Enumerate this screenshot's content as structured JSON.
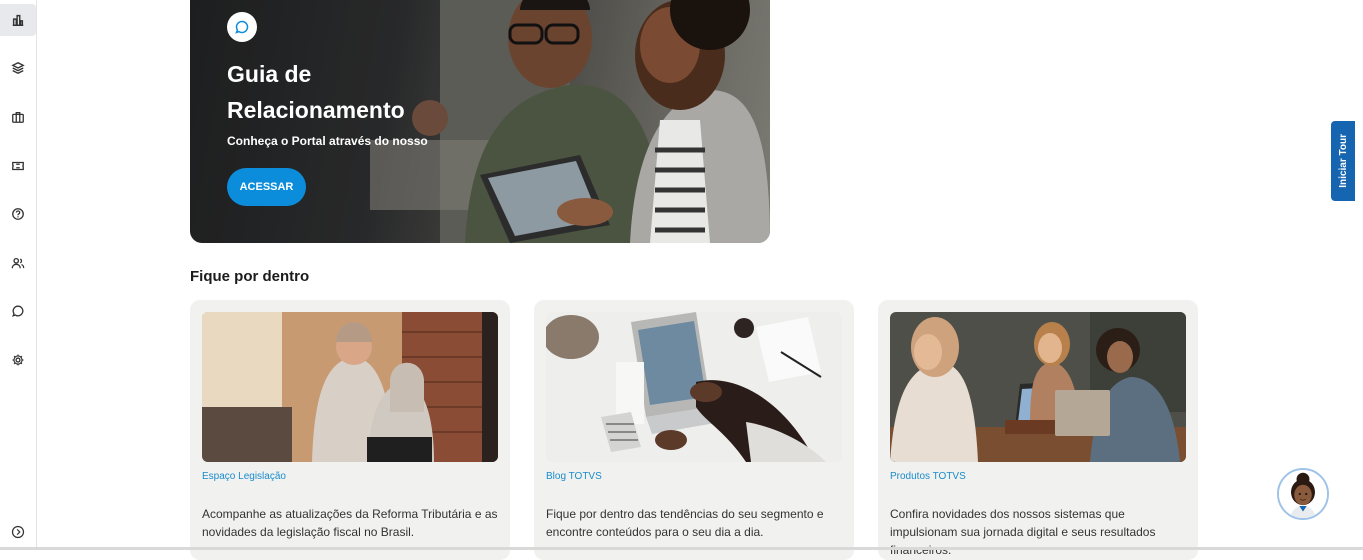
{
  "sidebar": {
    "items": [
      {
        "icon": "dashboard-icon"
      },
      {
        "icon": "layers-icon"
      },
      {
        "icon": "briefcase-icon"
      },
      {
        "icon": "ticket-icon"
      },
      {
        "icon": "help-icon"
      },
      {
        "icon": "users-icon"
      },
      {
        "icon": "chat-icon"
      },
      {
        "icon": "settings-icon"
      }
    ],
    "expand_icon": "chevron-right-circle-icon"
  },
  "hero": {
    "title": "Guia de Relacionamento",
    "subtitle": "Conheça o Portal através do nosso",
    "button": "ACESSAR",
    "badge_icon": "chat-bubble-icon"
  },
  "section_title": "Fique por dentro",
  "cards": [
    {
      "tag": "Espaço Legislação",
      "description": "Acompanhe as atualizações da Reforma Tributária e as novidades da legislação fiscal no Brasil."
    },
    {
      "tag": "Blog TOTVS",
      "description": "Fique por dentro das tendências do seu segmento e encontre conteúdos para o seu dia a dia."
    },
    {
      "tag": "Produtos TOTVS",
      "description": "Confira novidades dos nossos sistemas que impulsionam sua jornada digital e seus resultados financeiros."
    }
  ],
  "tour_button": "Iniciar Tour",
  "colors": {
    "accent": "#0c8ddb",
    "tag": "#1a8ccb",
    "tour": "#1565b0"
  }
}
